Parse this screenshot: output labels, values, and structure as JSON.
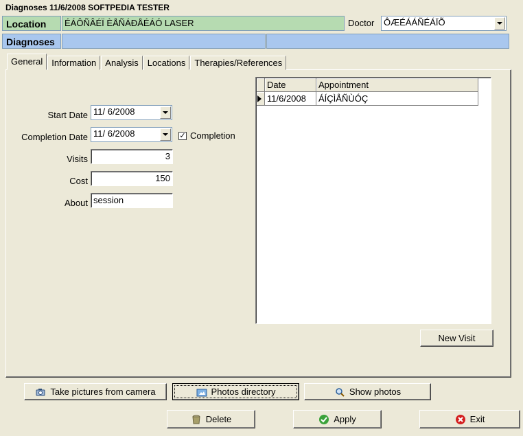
{
  "window": {
    "title": "Diagnoses 11/6/2008 SOFTPEDIA TESTER"
  },
  "header": {
    "location_label": "Location",
    "location_value": "ÉÁÔÑÂÉÏ ÈÅÑÁÐÅÉÁÓ LASER",
    "doctor_label": "Doctor",
    "doctor_value": "ÔÆÉÁÁÑÉÁÏÕ",
    "diagnoses_label": "Diagnoses"
  },
  "tabs": [
    {
      "label": "General"
    },
    {
      "label": "Information"
    },
    {
      "label": "Analysis"
    },
    {
      "label": "Locations"
    },
    {
      "label": "Therapies/References"
    }
  ],
  "form": {
    "start_date_label": "Start Date",
    "start_date_value": "11/  6/2008",
    "completion_date_label": "Completion Date",
    "completion_date_value": "11/  6/2008",
    "completion_check_label": "Completion",
    "completion_checked": true,
    "visits_label": "Visits",
    "visits_value": "3",
    "cost_label": "Cost",
    "cost_value": "150",
    "about_label": "About",
    "about_value": "session"
  },
  "grid": {
    "columns": [
      "Date",
      "Appointment"
    ],
    "rows": [
      {
        "date": "11/6/2008",
        "appointment": "ÁÍÇÌÅÑÙÓÇ"
      }
    ]
  },
  "buttons": {
    "new_visit": "New Visit",
    "take_pictures": "Take pictures from camera",
    "photos_directory": "Photos directory",
    "show_photos": "Show photos",
    "delete": "Delete",
    "apply": "Apply",
    "exit": "Exit"
  },
  "colors": {
    "location_bg": "#b6dbb1",
    "diagnoses_bg": "#a9c7ee",
    "window_bg": "#ece9d8"
  }
}
